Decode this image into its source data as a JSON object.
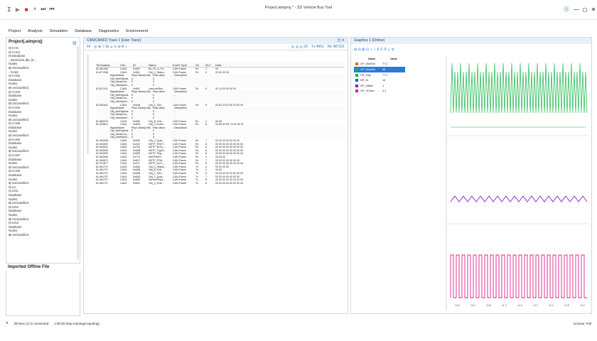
{
  "window": {
    "title": "Project.aimproj * - ZD Vehicle Bus Tool"
  },
  "menu": [
    "Project",
    "Analysis",
    "Simulation",
    "Database",
    "Diagnostics",
    "Environment"
  ],
  "sidebar": {
    "title": "Project(.aimproj)",
    "tree": [
      "⊟ CAN",
      " ⊟ CAN1",
      "  ⊟ Database",
      "   ◦ ZDVehicle.dbc (K...",
      "  Nodes",
      "  ⊞ Unclassified",
      "   ◦ Script",
      " ⊟ CAN2",
      "  Database",
      "  Nodes",
      "  ⊞ Unclassified",
      " ⊟ CAN3",
      "  Database",
      "  Nodes",
      "  ⊞ Unclassified",
      " ⊟ CAN4",
      "  Database",
      "  Nodes",
      "  ⊞ Unclassified",
      " ⊟ CAN5",
      "  Database",
      "  Nodes",
      "  ⊞ Unclassified",
      " ⊟ CAN6",
      "  Database",
      "  Nodes",
      "  ⊞ Unclassified",
      " ⊟ CAN7",
      "  Database",
      "  Nodes",
      "  ⊞ Unclassified",
      " ⊟ CAN8",
      "  Database",
      "  Nodes",
      "  ⊞ Unclassified",
      "⊟ Lin",
      " ⊟ LIN1",
      "  Database",
      "  Nodes",
      "  ⊞ Unclassified",
      " ⊟ LIN2",
      "  Database",
      "  Nodes",
      "  ⊞ Unclassified",
      " ⊟ LIN3",
      "  Database",
      "  Nodes",
      "  ⊞ Unclassified"
    ],
    "offline_title": "Imported Offline File"
  },
  "trace": {
    "title": "CAN/CANFD Trace 1 [User Trace]",
    "toolbar": [
      "Fil",
      "◎ ⊕ ▽ ⊞ ⊿ ⊙ ⊘ A ⊹"
    ],
    "toolbar_right": [
      "◎ ◎ ◎ 29",
      "Tx 4651",
      "Rx 487101"
    ],
    "columns": [
      "Timestamp",
      "Chn",
      "ID",
      "Name",
      "Event Type",
      "Dir",
      "DLC",
      "Data"
    ],
    "rows": [
      [
        "81.581356",
        "CAN1",
        "0x60F",
        "Bit_Pit_A_Fe...",
        "CAN Frame",
        "Rx",
        "1",
        "00"
      ],
      [
        "81.871358",
        "CAN1",
        "0x601",
        "Obj_0_Status...",
        "CAN Frame",
        "Rx",
        "4",
        "00 00 00 00"
      ],
      [
        "81.821311",
        "CAN1",
        "0x60F",
        "UserInfoRes...",
        "CAN Frame",
        "Rx",
        "8",
        "00 14 00 00 00 00"
      ],
      [
        "81.852841",
        "CAN1",
        "0x60B",
        "Obj_1_Gen...",
        "CAN Frame",
        "Rx",
        "8",
        "00 A2 23 91 80 20 80 00"
      ],
      [
        "81.869075",
        "CAN1",
        "0x60E",
        "Obj_B_Flat...",
        "CAN Frame",
        "Rx",
        "2",
        "00 80"
      ],
      [
        "81.909601",
        "CAN1",
        "0x60D",
        "Obj_3_Exten...",
        "CAN Frame",
        "Rx",
        "8",
        "00 80 99 FB 75 40 45 00"
      ],
      [
        "81.954356",
        "CAN1",
        "0x60E",
        "Obj_2_Qual...",
        "CAN Frame",
        "Rx",
        "7",
        "00 00 00 00 00 00 00"
      ],
      [
        "81.954393",
        "CAN1",
        "0x202",
        "NETP_RSET...",
        "CAN Frame",
        "Rx",
        "8",
        "00 00 00 00 00 00 00 00"
      ],
      [
        "81.954901",
        "CAN1",
        "0x708",
        "NETP_BCM_...",
        "CAN Frame",
        "Rx",
        "8",
        "00 00 00 00 00 00 00 00"
      ],
      [
        "81.954905",
        "CAN1",
        "0x60B",
        "NETP_TrgUS...",
        "CAN Frame",
        "Rx",
        "8",
        "00 00 00 00 00 00 00 00"
      ],
      [
        "81.954900",
        "CAN1",
        "0x60E",
        "NETP_Ptrg...",
        "CAN Frame",
        "Rx",
        "8",
        "00 00 00 00 00 00 00 00"
      ],
      [
        "81.954906",
        "CAN1",
        "0x775",
        "WAFEedFt...",
        "CAN Frame",
        "Rx",
        "4",
        "2A 00 00"
      ],
      [
        "81.954871",
        "CAN1",
        "0x61F",
        "NETP_R7M...",
        "CAN Frame",
        "Rx",
        "7",
        "00 00 00 00 00 00 00"
      ],
      [
        "81.971877",
        "CAN1",
        "0x271",
        "NETP_ACC_...",
        "CAN Frame",
        "Rx",
        "8",
        "00 00 00 00 00 00 00 00"
      ],
      [
        "81.961707",
        "CAN1",
        "0x60A",
        "Obj_0_Status...",
        "CAN Frame",
        "Tx",
        "4",
        "00 00 00 00"
      ],
      [
        "81.961707",
        "CAN1",
        "0x60B",
        "Obj_B_Flat...",
        "CAN Frame",
        "Tx",
        "2",
        "00 00"
      ],
      [
        "81.961707",
        "CAN1",
        "0x60B",
        "Obj_1_Gen...",
        "CAN Frame",
        "Tx",
        "8",
        "00 00 00 00 00 00 00 00"
      ],
      [
        "81.961707",
        "CAN1",
        "0x60D",
        "Obj_2_Qual...",
        "CAN Frame",
        "Tx",
        "7",
        "00 00 00 00 00 00 00"
      ],
      [
        "81.961707",
        "CAN1",
        "0x60E",
        "SensorRead...",
        "CAN Frame",
        "Tx",
        "8",
        "00 00 00 00 00 00 00 00"
      ],
      [
        "81.961707",
        "CAN1",
        "0x60C",
        "Obj_3_Exte...",
        "CAN Frame",
        "Tx",
        "8",
        "00 00 00 00 00 00 00 00"
      ]
    ],
    "signal_block": {
      "header": [
        "SignalName",
        "Phys Value(Unit)",
        "Raw Value",
        "Description"
      ],
      "rows": [
        [
          "Obj_NofObjects",
          "0",
          "0",
          "-"
        ],
        [
          "Obj_MeasCou...",
          "0",
          "0",
          "-"
        ],
        [
          "Obj_InterfaceV...",
          "0",
          "0",
          "-"
        ]
      ]
    }
  },
  "graphics": {
    "title": "Graphics 1 [Online]",
    "signal_header": [
      "Name",
      "Value"
    ],
    "signals": [
      {
        "name": "OP_DistRoll",
        "value": "77.1",
        "color": "#e07020"
      },
      {
        "name": "OP_DistAlat",
        "value": "48",
        "color": "#18b84a"
      },
      {
        "name": "OP_Gap",
        "value": "77.1",
        "color": "#18b84a"
      },
      {
        "name": "NP_ID",
        "value": "16",
        "color": "#2060e0"
      },
      {
        "name": "OP_Offset",
        "value": "1",
        "color": "#8020d0"
      },
      {
        "name": "OP_VClaim",
        "value": "0.1",
        "color": "#e0208a"
      }
    ],
    "xticks": [
      "10.0",
      "10.4",
      "10.8",
      "11.2",
      "11.6",
      "12.0",
      "12.4",
      "12.8",
      "13.2"
    ]
  },
  "status": {
    "text": "ZD-Box (1) is connected",
    "time": "1:00:00  Stop running(Acquiring)",
    "right": "License: Full"
  }
}
